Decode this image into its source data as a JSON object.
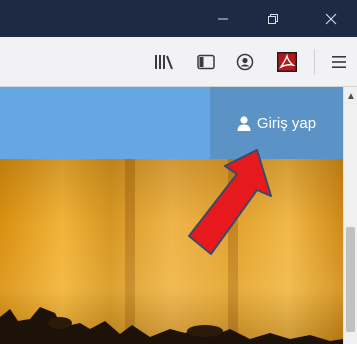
{
  "titlebar": {
    "icons": [
      "minimize-icon",
      "restore-icon",
      "close-icon"
    ]
  },
  "toolbar": {
    "icons": [
      "library-icon",
      "sidebar-icon",
      "account-icon",
      "pdf-icon",
      "menu-icon"
    ],
    "pdf_color": "#b0191e"
  },
  "header": {
    "login_label": "Giriş yap",
    "bar_color": "#64a7e4",
    "login_bg": "#5c93c7"
  },
  "annotation": {
    "arrow_color": "#e8191c"
  }
}
